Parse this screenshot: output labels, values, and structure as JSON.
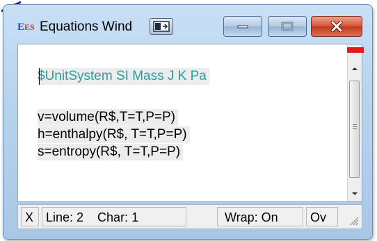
{
  "window": {
    "title": "Equations Wind",
    "app_icon": "ees-logo",
    "tile_icon": "tile-windows-icon",
    "controls": [
      "minimize-icon",
      "maximize-icon",
      "close-icon"
    ],
    "accent_color": "#c23a1e"
  },
  "editor": {
    "lines": [
      "$UnitSystem SI Mass J K Pa",
      "v=volume(R$,T=T,P=P)",
      "h=enthalpy(R$, T=T,P=P)",
      "s=entropy(R$, T=T,P=P)"
    ],
    "unit_line_color": "#2a9d9a",
    "marker_color": "#e01b1b"
  },
  "statusbar": {
    "x": "X",
    "line": "Line: 2",
    "char": "Char: 1",
    "wrap": "Wrap: On",
    "overwrite": "Ov"
  }
}
